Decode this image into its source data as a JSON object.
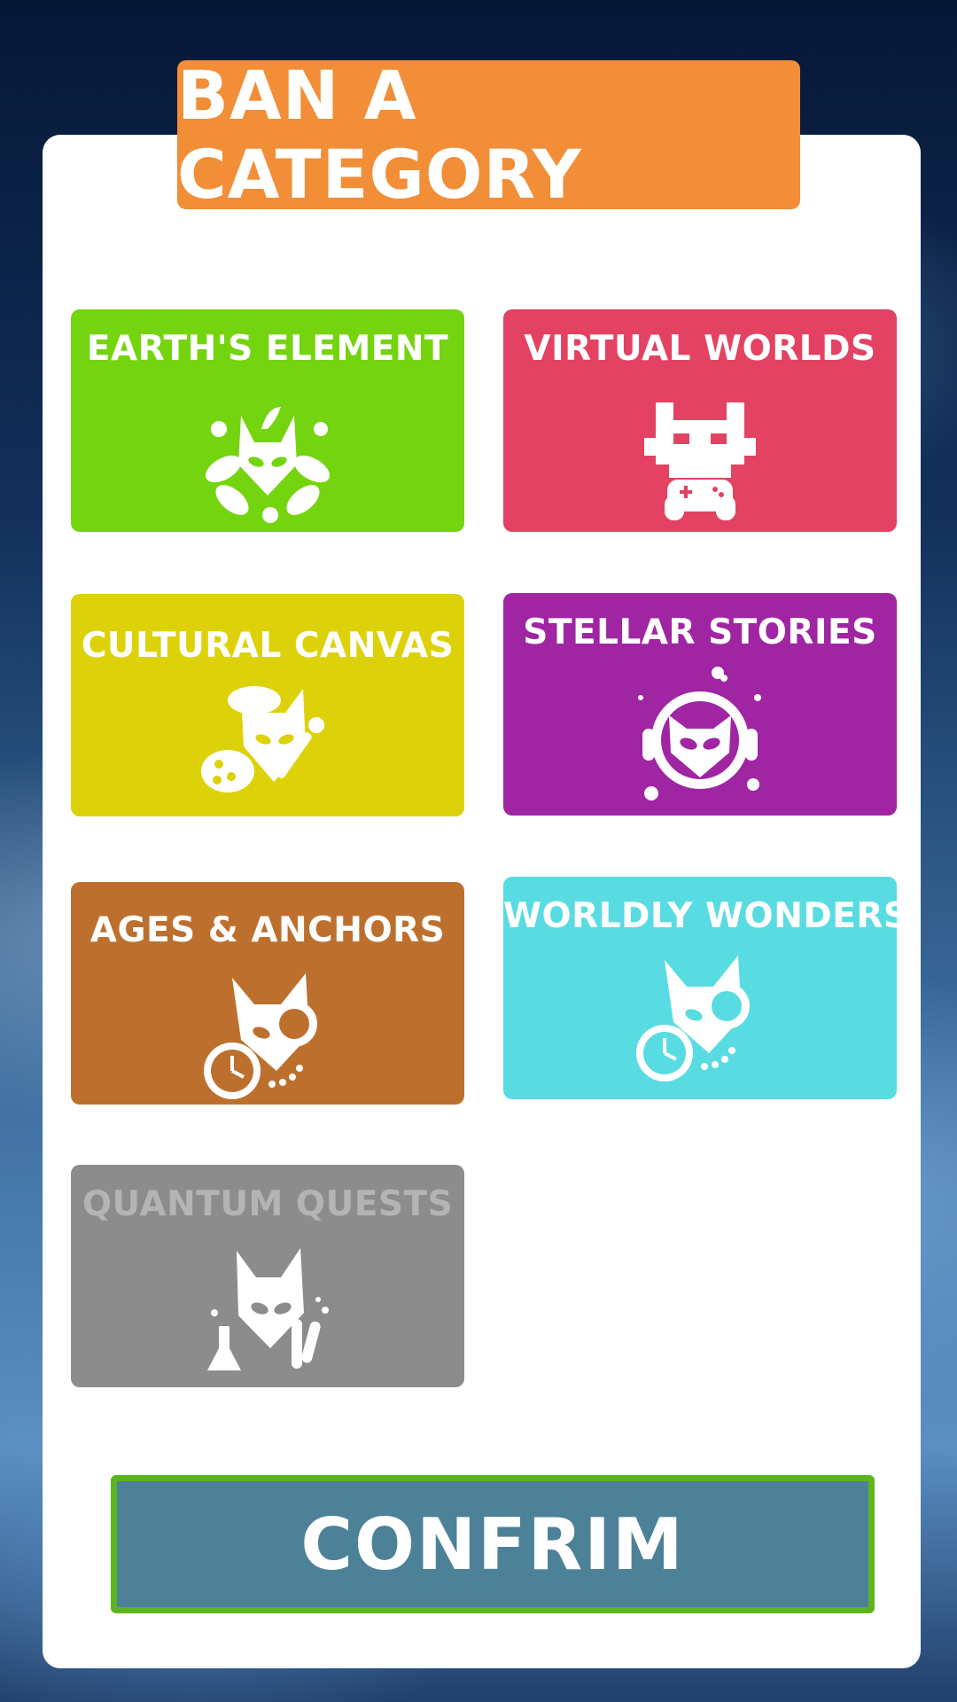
{
  "header": {
    "title": "BAN A CATEGORY"
  },
  "categories": [
    {
      "label": "EARTH'S ELEMENT",
      "color": "#74d40f",
      "icon": "fox-leaves-icon",
      "state": "active"
    },
    {
      "label": "VIRTUAL WORLDS",
      "color": "#e34262",
      "icon": "pixel-fox-gamepad-icon",
      "state": "active"
    },
    {
      "label": "CULTURAL CANVAS",
      "color": "#ddd20a",
      "icon": "fox-artist-palette-icon",
      "state": "active"
    },
    {
      "label": "STELLAR STORIES",
      "color": "#a025a2",
      "icon": "astronaut-fox-icon",
      "state": "active"
    },
    {
      "label": "AGES & ANCHORS",
      "color": "#bd702d",
      "icon": "fox-monocle-pocket-watch-icon",
      "state": "active"
    },
    {
      "label": "WORLDLY WONDERS",
      "color": "#58dce1",
      "icon": "fox-magnifier-watch-icon",
      "state": "active"
    },
    {
      "label": "QUANTUM QUESTS",
      "color": "#8c8c8c",
      "icon": "fox-lab-flask-icon",
      "state": "disabled"
    }
  ],
  "footer": {
    "confirm_label": "CONFRIM"
  }
}
